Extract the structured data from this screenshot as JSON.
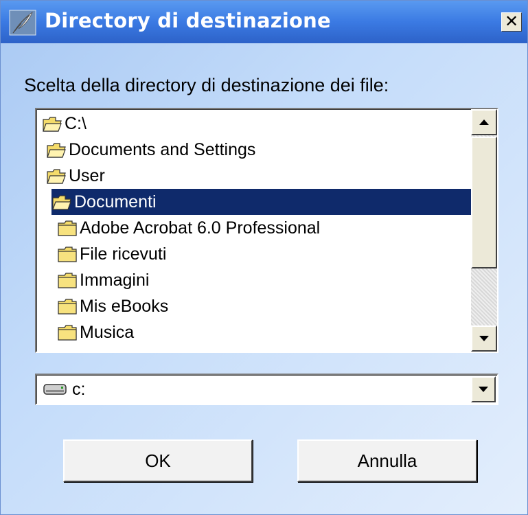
{
  "window": {
    "title": "Directory di destinazione",
    "close_label": "✕"
  },
  "prompt": "Scelta della directory di destinazione dei file:",
  "tree": {
    "items": [
      {
        "label": "C:\\",
        "indent": 0,
        "open": true,
        "selected": false
      },
      {
        "label": "Documents and Settings",
        "indent": 1,
        "open": true,
        "selected": false
      },
      {
        "label": "User",
        "indent": 1,
        "open": true,
        "selected": false
      },
      {
        "label": "Documenti",
        "indent": 2,
        "open": true,
        "selected": true
      },
      {
        "label": "Adobe Acrobat 6.0 Professional",
        "indent": 3,
        "open": false,
        "selected": false
      },
      {
        "label": "File ricevuti",
        "indent": 3,
        "open": false,
        "selected": false
      },
      {
        "label": "Immagini",
        "indent": 3,
        "open": false,
        "selected": false
      },
      {
        "label": "Mis eBooks",
        "indent": 3,
        "open": false,
        "selected": false
      },
      {
        "label": "Musica",
        "indent": 3,
        "open": false,
        "selected": false
      }
    ]
  },
  "drive": {
    "selected": "c:"
  },
  "buttons": {
    "ok": "OK",
    "cancel": "Annulla"
  },
  "colors": {
    "title_bar": "#3b7ae3",
    "selection": "#0f2a6b",
    "folder": "#f5dc6a"
  }
}
